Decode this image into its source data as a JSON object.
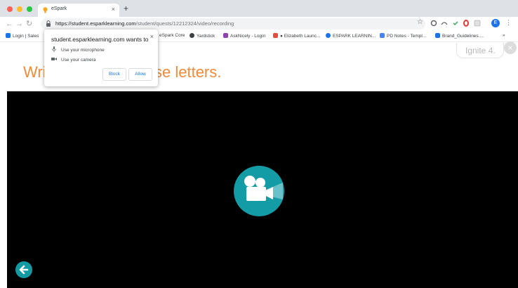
{
  "browser": {
    "tab_title": "eSpark",
    "new_tab_symbol": "+",
    "tab_close_symbol": "×",
    "url_domain": "https://student.esparklearning.com",
    "url_path": "/student/quests/12212324/video/recording",
    "profile_initial": "E",
    "menu_symbol": "⋮"
  },
  "bookmarks": [
    {
      "label": "Login | Sales",
      "color": "#1a73e8"
    },
    {
      "label": "eSpark Core",
      "color": "#ffffff"
    },
    {
      "label": "Yardstick",
      "color": "#3c4043"
    },
    {
      "label": "AskNicely - Login",
      "color": "#8e44ad"
    },
    {
      "label": "● Elizabeth Launc...",
      "color": "#e74c3c"
    },
    {
      "label": "ESPARK LEARNIN...",
      "color": "#1a73e8"
    },
    {
      "label": "PD Notes - Templ...",
      "color": "#4285f4"
    },
    {
      "label": "Brand_Guidelines....",
      "color": "#1e73e8"
    }
  ],
  "bookmarks_overflow": "»",
  "page": {
    "heading_visible_left": "Wri",
    "heading_visible_right": "se letters.",
    "ignite_label": "Ignite 4.",
    "ignite_close_symbol": "×"
  },
  "permission_popup": {
    "title": "student.esparklearning.com wants to",
    "close_symbol": "×",
    "items": [
      {
        "label": "Use your microphone",
        "icon": "microphone-icon"
      },
      {
        "label": "Use your camera",
        "icon": "camera-icon"
      }
    ],
    "block_label": "Block",
    "allow_label": "Allow"
  },
  "colors": {
    "accent_orange": "#f28b37",
    "teal": "#139ca5",
    "link_blue": "#1a73e8",
    "video_bg": "#000000"
  }
}
